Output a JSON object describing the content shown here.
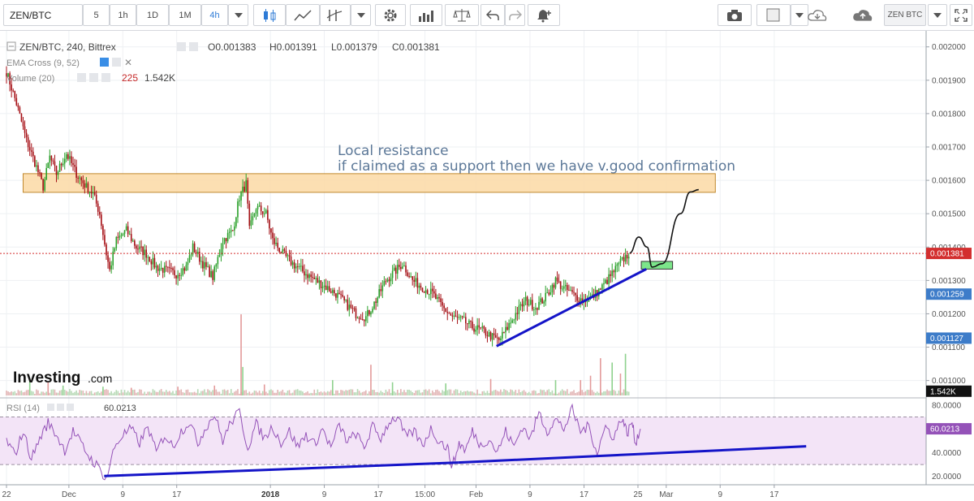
{
  "toolbar": {
    "symbol": "ZEN/BTC",
    "intervals": [
      "5",
      "1h",
      "1D",
      "1M",
      "4h"
    ],
    "active_interval": "4h",
    "symbol_button": "ZEN BTC"
  },
  "legend": {
    "pair": "ZEN/BTC, 240, Bittrex",
    "ohlc": [
      "O0.001383",
      "H0.001391",
      "L0.001379",
      "C0.001381"
    ],
    "ema": "EMA Cross (9, 52)",
    "volume_label": "Volume (20)",
    "volume_values": [
      "225",
      "1.542K"
    ],
    "rsi_label": "RSI (14)",
    "rsi_value": "60.0213",
    "logo": "Investing",
    "logo_suffix": ".com"
  },
  "annotations": {
    "line1": "Local resistance",
    "line2": "if claimed as a support then we have v.good confirmation"
  },
  "colors": {
    "up": "#2aa02a",
    "down": "#a50f15",
    "trendline": "#1414c8",
    "resistance_fill": "#fcd9a5",
    "resistance_stroke": "#c0882d",
    "support_fill": "#7ce58a",
    "current_price": "#d32f2f",
    "ema_price": "#3d7cc9",
    "rsi_line": "#9452b8",
    "rsi_band": "#f3e4f7"
  },
  "chart_data": {
    "type": "candlestick",
    "price_axis": {
      "ylim": [
        0.000948,
        0.002048
      ],
      "ticks": [
        "0.002000",
        "0.001900",
        "0.001800",
        "0.001700",
        "0.001600",
        "0.001500",
        "0.001400",
        "0.001300",
        "0.001200",
        "0.001100",
        "0.001000"
      ]
    },
    "tags": [
      {
        "value": 0.001381,
        "label": "0.001381",
        "color": "#d32f2f"
      },
      {
        "value": 0.001259,
        "label": "0.001259",
        "color": "#3d7cc9"
      },
      {
        "value": 0.001127,
        "label": "0.001127",
        "color": "#3d7cc9"
      },
      {
        "value": 0.000968,
        "label": "1.542K",
        "color": "#111111"
      }
    ],
    "x_ticks": [
      {
        "i": 0,
        "label": "22"
      },
      {
        "i": 37.5,
        "label": "Dec"
      },
      {
        "i": 69.9,
        "label": "9"
      },
      {
        "i": 102.3,
        "label": "17"
      },
      {
        "i": 158.6,
        "label": "2018"
      },
      {
        "i": 191,
        "label": "9"
      },
      {
        "i": 223.5,
        "label": "17"
      },
      {
        "i": 251.5,
        "label": "15:00"
      },
      {
        "i": 282.2,
        "label": "Feb"
      },
      {
        "i": 314.6,
        "label": "9"
      },
      {
        "i": 347.1,
        "label": "17"
      },
      {
        "i": 379.5,
        "label": "25"
      },
      {
        "i": 396.5,
        "label": "Mar"
      },
      {
        "i": 428.9,
        "label": "9"
      },
      {
        "i": 461.4,
        "label": "17"
      }
    ],
    "price_path": [
      [
        0,
        0.001925
      ],
      [
        6,
        0.00183
      ],
      [
        12,
        0.00172
      ],
      [
        18,
        0.00164
      ],
      [
        22,
        0.00158
      ],
      [
        26,
        0.00167
      ],
      [
        30,
        0.00162
      ],
      [
        36,
        0.00168
      ],
      [
        42,
        0.00162
      ],
      [
        48,
        0.00158
      ],
      [
        52,
        0.00156
      ],
      [
        56,
        0.0015
      ],
      [
        60,
        0.00138
      ],
      [
        62,
        0.00133
      ],
      [
        66,
        0.00142
      ],
      [
        72,
        0.00145
      ],
      [
        78,
        0.0014
      ],
      [
        84,
        0.00138
      ],
      [
        90,
        0.00134
      ],
      [
        96,
        0.00133
      ],
      [
        102,
        0.00132
      ],
      [
        108,
        0.00134
      ],
      [
        112,
        0.0014
      ],
      [
        118,
        0.00135
      ],
      [
        124,
        0.00131
      ],
      [
        130,
        0.00142
      ],
      [
        136,
        0.00145
      ],
      [
        140,
        0.00155
      ],
      [
        144,
        0.00159
      ],
      [
        146,
        0.00145
      ],
      [
        150,
        0.00152
      ],
      [
        156,
        0.0015
      ],
      [
        160,
        0.00142
      ],
      [
        166,
        0.00138
      ],
      [
        172,
        0.00135
      ],
      [
        180,
        0.00132
      ],
      [
        186,
        0.0013
      ],
      [
        192,
        0.00128
      ],
      [
        198,
        0.00126
      ],
      [
        204,
        0.00123
      ],
      [
        210,
        0.0012
      ],
      [
        216,
        0.00119
      ],
      [
        222,
        0.00124
      ],
      [
        228,
        0.0013
      ],
      [
        234,
        0.00133
      ],
      [
        238,
        0.00135
      ],
      [
        244,
        0.0013
      ],
      [
        250,
        0.00128
      ],
      [
        256,
        0.00126
      ],
      [
        262,
        0.00122
      ],
      [
        268,
        0.00119
      ],
      [
        274,
        0.00118
      ],
      [
        280,
        0.00116
      ],
      [
        286,
        0.00115
      ],
      [
        292,
        0.00113
      ],
      [
        296,
        0.00112
      ],
      [
        300,
        0.00115
      ],
      [
        306,
        0.0012
      ],
      [
        312,
        0.00124
      ],
      [
        318,
        0.00122
      ],
      [
        324,
        0.00125
      ],
      [
        330,
        0.0013
      ],
      [
        334,
        0.00128
      ],
      [
        340,
        0.00126
      ],
      [
        346,
        0.00124
      ],
      [
        352,
        0.00125
      ],
      [
        358,
        0.00128
      ],
      [
        364,
        0.00132
      ],
      [
        370,
        0.00136
      ],
      [
        374,
        0.001381
      ]
    ],
    "resistance_zone": {
      "x_range": [
        10,
        426
      ],
      "y_range": [
        0.001564,
        0.00162
      ]
    },
    "support_zone": {
      "x_range": [
        381.5,
        400.3
      ],
      "y_range": [
        0.001334,
        0.001357
      ]
    },
    "price_trendline": [
      [
        294.5,
        0.001103
      ],
      [
        384.5,
        0.001334
      ]
    ],
    "projection_path": [
      [
        374.5,
        0.001382
      ],
      [
        380,
        0.00143
      ],
      [
        385,
        0.0014
      ],
      [
        388,
        0.00134
      ],
      [
        394,
        0.00135
      ],
      [
        405,
        0.0015
      ],
      [
        411,
        0.001565
      ],
      [
        416,
        0.001572
      ]
    ],
    "volume": [
      {
        "i": 14,
        "v": 0.16
      },
      {
        "i": 25,
        "v": 0.12
      },
      {
        "i": 34,
        "v": 0.09
      },
      {
        "i": 58,
        "v": 0.08
      },
      {
        "i": 75,
        "v": 0.07
      },
      {
        "i": 103,
        "v": 0.08
      },
      {
        "i": 125,
        "v": 0.09
      },
      {
        "i": 141,
        "v": 0.74
      },
      {
        "i": 142,
        "v": 0.26
      },
      {
        "i": 155,
        "v": 0.1
      },
      {
        "i": 196,
        "v": 0.14
      },
      {
        "i": 219,
        "v": 0.28
      },
      {
        "i": 232,
        "v": 0.12
      },
      {
        "i": 264,
        "v": 0.11
      },
      {
        "i": 291,
        "v": 0.15
      },
      {
        "i": 330,
        "v": 0.14
      },
      {
        "i": 345,
        "v": 0.14
      },
      {
        "i": 351,
        "v": 0.18
      },
      {
        "i": 357,
        "v": 0.34
      },
      {
        "i": 364,
        "v": 0.3
      },
      {
        "i": 369,
        "v": 0.2
      },
      {
        "i": 372,
        "v": 0.38
      }
    ],
    "rsi_axis": {
      "ylim": [
        13,
        86
      ],
      "ticks": [
        "80.0000",
        "60.0000",
        "40.0000",
        "20.0000"
      ],
      "band": [
        30,
        70
      ]
    },
    "rsi": [
      [
        0,
        50
      ],
      [
        5,
        38
      ],
      [
        10,
        58
      ],
      [
        15,
        35
      ],
      [
        20,
        52
      ],
      [
        25,
        65
      ],
      [
        30,
        55
      ],
      [
        35,
        42
      ],
      [
        40,
        58
      ],
      [
        45,
        47
      ],
      [
        50,
        36
      ],
      [
        55,
        28
      ],
      [
        60,
        18
      ],
      [
        65,
        45
      ],
      [
        70,
        55
      ],
      [
        75,
        60
      ],
      [
        80,
        48
      ],
      [
        85,
        62
      ],
      [
        90,
        40
      ],
      [
        95,
        55
      ],
      [
        100,
        45
      ],
      [
        105,
        58
      ],
      [
        110,
        66
      ],
      [
        115,
        48
      ],
      [
        120,
        62
      ],
      [
        125,
        72
      ],
      [
        130,
        50
      ],
      [
        135,
        66
      ],
      [
        140,
        74
      ],
      [
        145,
        44
      ],
      [
        150,
        64
      ],
      [
        155,
        52
      ],
      [
        160,
        62
      ],
      [
        165,
        48
      ],
      [
        170,
        58
      ],
      [
        175,
        45
      ],
      [
        180,
        55
      ],
      [
        185,
        47
      ],
      [
        190,
        60
      ],
      [
        195,
        44
      ],
      [
        200,
        63
      ],
      [
        205,
        49
      ],
      [
        210,
        56
      ],
      [
        215,
        44
      ],
      [
        220,
        62
      ],
      [
        225,
        52
      ],
      [
        230,
        66
      ],
      [
        235,
        70
      ],
      [
        240,
        53
      ],
      [
        245,
        58
      ],
      [
        250,
        46
      ],
      [
        255,
        60
      ],
      [
        260,
        50
      ],
      [
        265,
        44
      ],
      [
        268,
        28
      ],
      [
        272,
        48
      ],
      [
        276,
        42
      ],
      [
        280,
        58
      ],
      [
        285,
        46
      ],
      [
        290,
        52
      ],
      [
        295,
        40
      ],
      [
        300,
        58
      ],
      [
        305,
        45
      ],
      [
        310,
        62
      ],
      [
        315,
        52
      ],
      [
        320,
        74
      ],
      [
        325,
        58
      ],
      [
        330,
        68
      ],
      [
        335,
        60
      ],
      [
        340,
        76
      ],
      [
        345,
        58
      ],
      [
        350,
        62
      ],
      [
        355,
        40
      ],
      [
        360,
        62
      ],
      [
        365,
        53
      ],
      [
        370,
        70
      ],
      [
        373,
        56
      ],
      [
        376,
        66
      ],
      [
        378,
        48
      ],
      [
        381,
        60
      ]
    ],
    "rsi_trendlines": [
      [
        [
          58.7,
          20.3
        ],
        [
          271.6,
          31.7
        ]
      ],
      [
        [
          271.6,
          31.7
        ],
        [
          480.6,
          45.3
        ]
      ]
    ]
  }
}
